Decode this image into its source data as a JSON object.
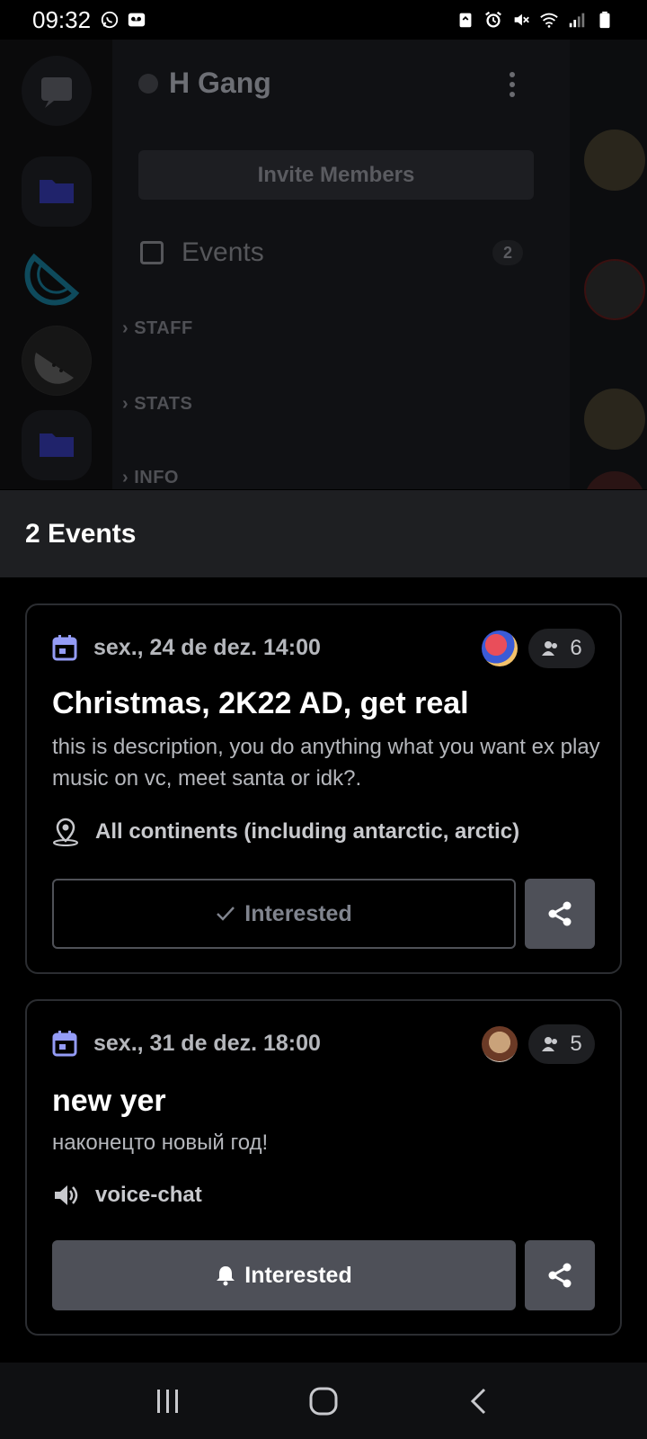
{
  "status_bar": {
    "time": "09:32",
    "left_icons": [
      "whatsapp-icon",
      "voicemail-icon"
    ],
    "right_icons": [
      "recycle-icon",
      "alarm-icon",
      "mute-icon",
      "wifi-icon",
      "signal-icon",
      "battery-icon"
    ]
  },
  "background": {
    "server_name": "H Gang",
    "invite_label": "Invite Members",
    "events_label": "Events",
    "events_count": "2",
    "categories": [
      "STAFF",
      "STATS",
      "INFO"
    ]
  },
  "sheet": {
    "title": "2 Events"
  },
  "events": [
    {
      "date": "sex., 24 de dez. 14:00",
      "title": "Christmas, 2K22 AD, get real",
      "description": "this is description, you do anything what you want ex play music on vc, meet santa or idk?.",
      "location": "All continents (including antarctic, arctic)",
      "location_icon": "location-pin-icon",
      "count": "6",
      "interested_label": "Interested",
      "interested_state": "checked"
    },
    {
      "date": "sex., 31 de dez. 18:00",
      "title": "new yer",
      "description": "наконецто новый год!",
      "location": "voice-chat",
      "location_icon": "speaker-icon",
      "count": "5",
      "interested_label": "Interested",
      "interested_state": "bell"
    }
  ],
  "colors": {
    "accent_calendar": "#949cf7",
    "card_border": "#2b2d31",
    "button_gray": "#4e5058"
  }
}
